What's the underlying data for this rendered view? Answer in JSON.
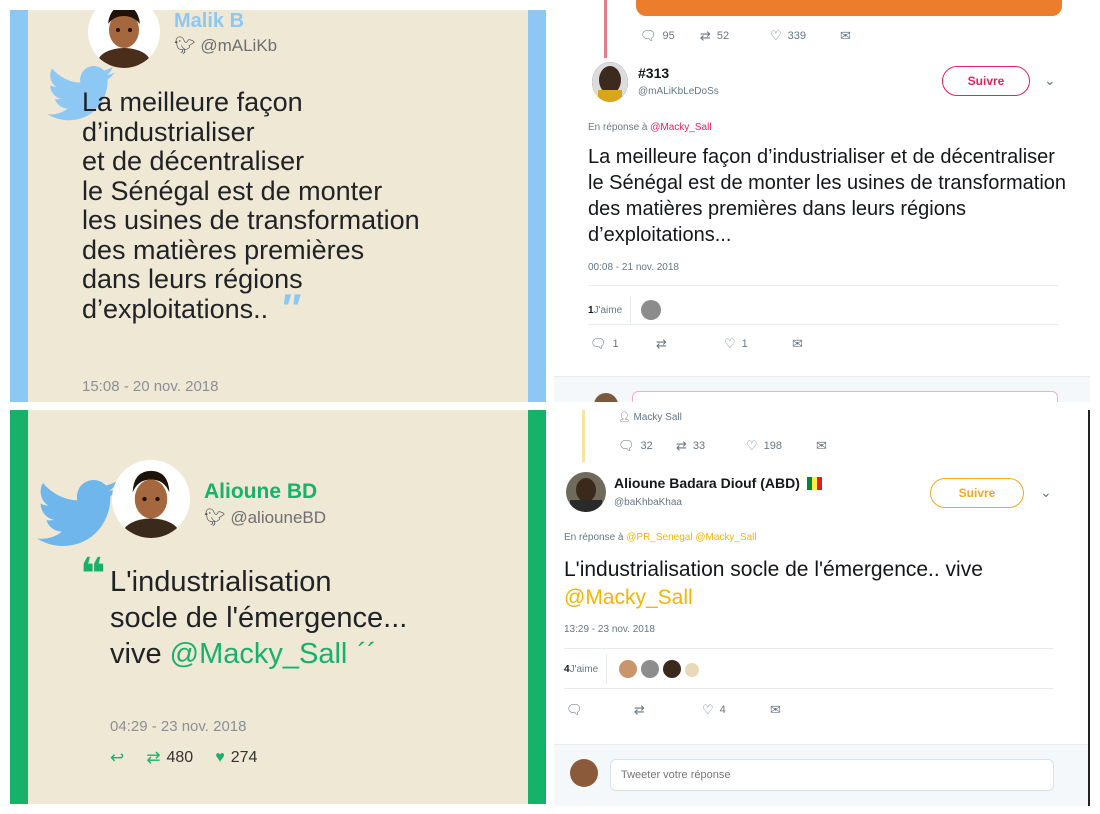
{
  "card_top": {
    "name": "Malik B",
    "handle": "@mALiKb",
    "quote_lines": [
      "La meilleure façon",
      "d’industrialiser",
      "et de décentraliser",
      "le Sénégal est de monter",
      "les usines de transformation",
      "des matières premières",
      "dans leurs régions",
      "d’exploitations.."
    ],
    "date": "15:08 - 20 nov. 2018"
  },
  "card_bottom": {
    "name": "Alioune BD",
    "handle": "@aliouneBD",
    "quote_line1": "L'industrialisation",
    "quote_line2": "socle de l'émergence...",
    "quote_line3_prefix": "vive ",
    "quote_mention": "@Macky_Sall",
    "date": "04:29 - 23 nov. 2018",
    "retweets": "480",
    "likes": "274"
  },
  "tweet_top": {
    "prev_stats": {
      "replies": "95",
      "retweets": "52",
      "likes": "339"
    },
    "name": "#313",
    "handle": "@mALiKbLeDoSs",
    "follow_label": "Suivre",
    "reply_prefix": "En réponse à ",
    "reply_to": "@Macky_Sall",
    "text": "La meilleure façon d’industrialiser et de décentraliser le Sénégal est de monter les usines de transformation des matières premières dans leurs régions d’exploitations...",
    "timestamp": "00:08 - 21 nov. 2018",
    "likes_count": "1",
    "likes_label": " J'aime",
    "stats": {
      "replies": "1",
      "retweets": "",
      "likes": "1"
    }
  },
  "tweet_bottom": {
    "context_user": "Macky Sall",
    "prev_stats": {
      "replies": "32",
      "retweets": "33",
      "likes": "198"
    },
    "name": "Alioune Badara Diouf (ABD)",
    "handle": "@baKhbaKhaa",
    "follow_label": "Suivre",
    "reply_prefix": "En réponse à ",
    "reply_to": "@PR_Senegal @Macky_Sall",
    "text_line1": "L'industrialisation socle de l'émergence.. vive",
    "text_mention": "@Macky_Sall",
    "timestamp": "13:29 - 23 nov. 2018",
    "likes_count": "4",
    "likes_label": " J'aime",
    "stats": {
      "replies": "",
      "retweets": "",
      "likes": "4"
    },
    "reply_placeholder": "Tweeter votre réponse"
  },
  "colors": {
    "cream": "#efe8d4",
    "blue_bar": "#8dc8f5",
    "green_bar": "#17b26a",
    "tw_blue": "#1da1f2",
    "follow_red": "#e0245e",
    "follow_orange": "#f5a623",
    "mention_orange": "#f5b400"
  }
}
